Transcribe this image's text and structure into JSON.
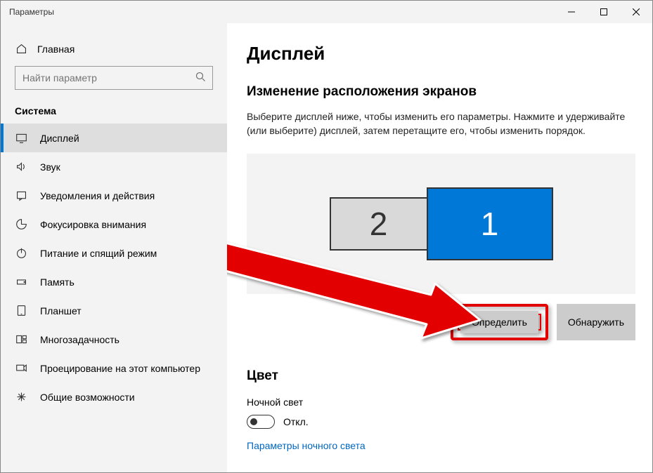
{
  "window": {
    "title": "Параметры"
  },
  "sidebar": {
    "home_label": "Главная",
    "search_placeholder": "Найти параметр",
    "section_label": "Система",
    "items": [
      {
        "label": "Дисплей",
        "icon": "display-icon",
        "active": true
      },
      {
        "label": "Звук",
        "icon": "sound-icon",
        "active": false
      },
      {
        "label": "Уведомления и действия",
        "icon": "notifications-icon",
        "active": false
      },
      {
        "label": "Фокусировка внимания",
        "icon": "focus-icon",
        "active": false
      },
      {
        "label": "Питание и спящий режим",
        "icon": "power-icon",
        "active": false
      },
      {
        "label": "Память",
        "icon": "storage-icon",
        "active": false
      },
      {
        "label": "Планшет",
        "icon": "tablet-icon",
        "active": false
      },
      {
        "label": "Многозадачность",
        "icon": "multitask-icon",
        "active": false
      },
      {
        "label": "Проецирование на этот компьютер",
        "icon": "project-icon",
        "active": false
      },
      {
        "label": "Общие возможности",
        "icon": "shared-icon",
        "active": false
      }
    ]
  },
  "main": {
    "title": "Дисплей",
    "arrange_heading": "Изменение расположения экранов",
    "arrange_desc": "Выберите дисплей ниже, чтобы изменить его параметры. Нажмите и удерживайте (или выберите) дисплей, затем перетащите его, чтобы изменить порядок.",
    "monitors": {
      "m1": "1",
      "m2": "2"
    },
    "identify_btn": "Определить",
    "detect_btn": "Обнаружить",
    "color_heading": "Цвет",
    "night_light_label": "Ночной свет",
    "toggle_state": "Откл.",
    "night_light_link": "Параметры ночного света"
  }
}
